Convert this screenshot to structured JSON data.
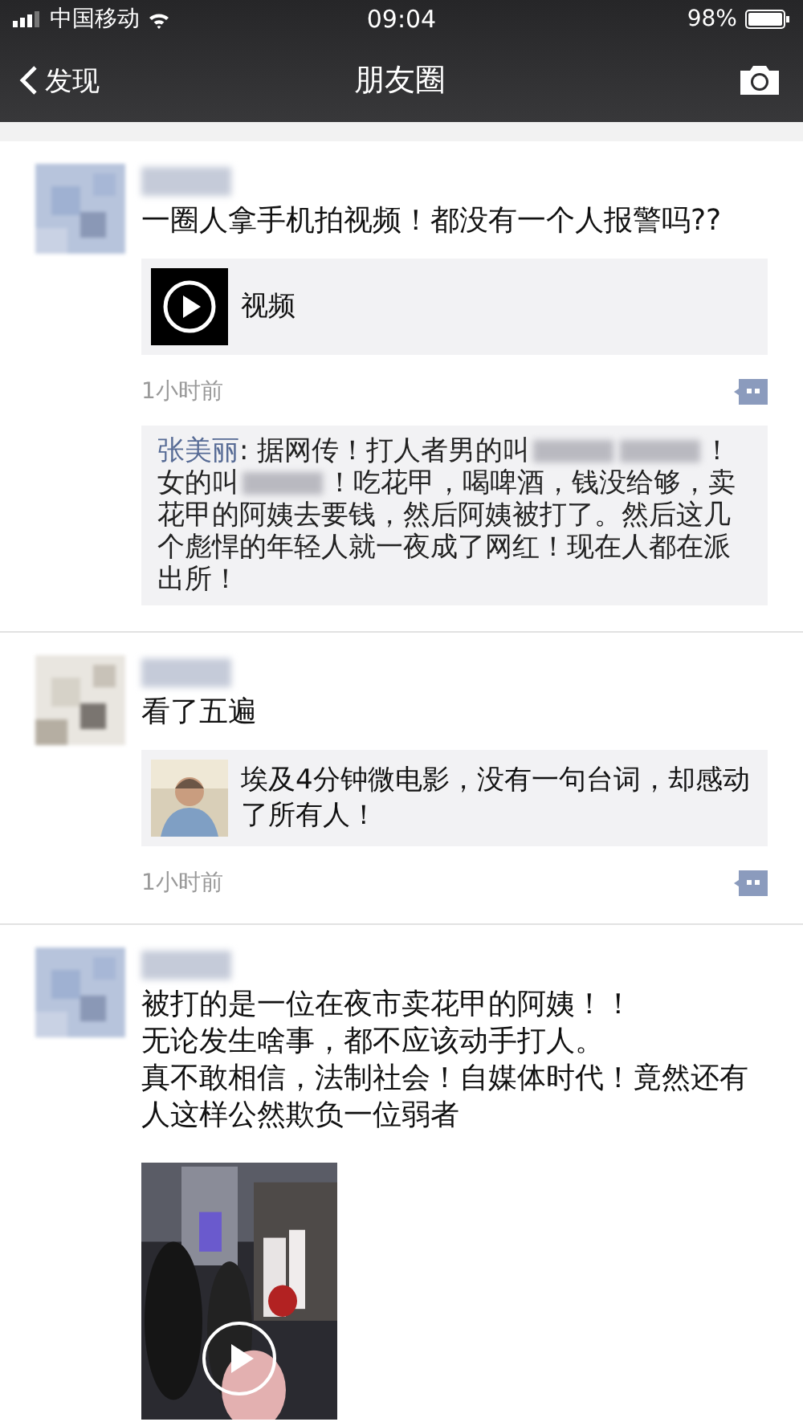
{
  "status_bar": {
    "carrier": "中国移动",
    "time": "09:04",
    "battery": "98%"
  },
  "nav": {
    "back": "发现",
    "title": "朋友圈"
  },
  "posts": [
    {
      "text": "一圈人拿手机拍视频！都没有一个人报警吗??",
      "attachment": {
        "kind": "video_link",
        "label": "视频"
      },
      "time": "1小时前",
      "comments": [
        {
          "author": "张美丽",
          "parts": [
            {
              "kind": "text",
              "text": ": 据网传！打人者男的叫"
            },
            {
              "kind": "blur"
            },
            {
              "kind": "blur"
            },
            {
              "kind": "text",
              "text": "！女的叫"
            },
            {
              "kind": "blur"
            },
            {
              "kind": "text",
              "text": "！吃花甲，喝啤酒，钱没给够，卖花甲的阿姨去要钱，然后阿姨被打了。然后这几个彪悍的年轻人就一夜成了网红！现在人都在派出所！"
            }
          ]
        }
      ]
    },
    {
      "text": "看了五遍",
      "attachment": {
        "kind": "article_link",
        "label": "埃及4分钟微电影，没有一句台词，却感动了所有人！"
      },
      "time": "1小时前"
    },
    {
      "lines": [
        "被打的是一位在夜市卖花甲的阿姨！！",
        "无论发生啥事，都不应该动手打人。",
        "真不敢相信，法制社会！自媒体时代！竟然还有人这样公然欺负一位弱者"
      ],
      "attachment": {
        "kind": "video"
      }
    }
  ]
}
